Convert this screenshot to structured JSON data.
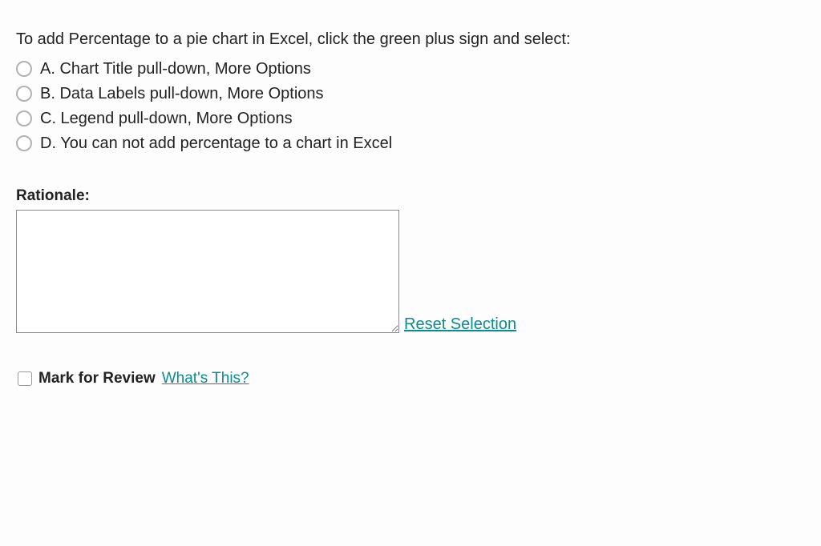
{
  "question": {
    "prompt": "To add Percentage to a pie chart in Excel, click the green plus sign and select:",
    "options": [
      {
        "label": "A. Chart Title pull-down, More Options"
      },
      {
        "label": "B. Data Labels pull-down, More Options"
      },
      {
        "label": "C. Legend pull-down, More Options"
      },
      {
        "label": "D. You can not add percentage to a chart in Excel"
      }
    ]
  },
  "rationale": {
    "heading": "Rationale:",
    "value": ""
  },
  "actions": {
    "reset_label": "Reset Selection"
  },
  "review": {
    "label": "Mark for Review",
    "help_label": " What's This?"
  }
}
